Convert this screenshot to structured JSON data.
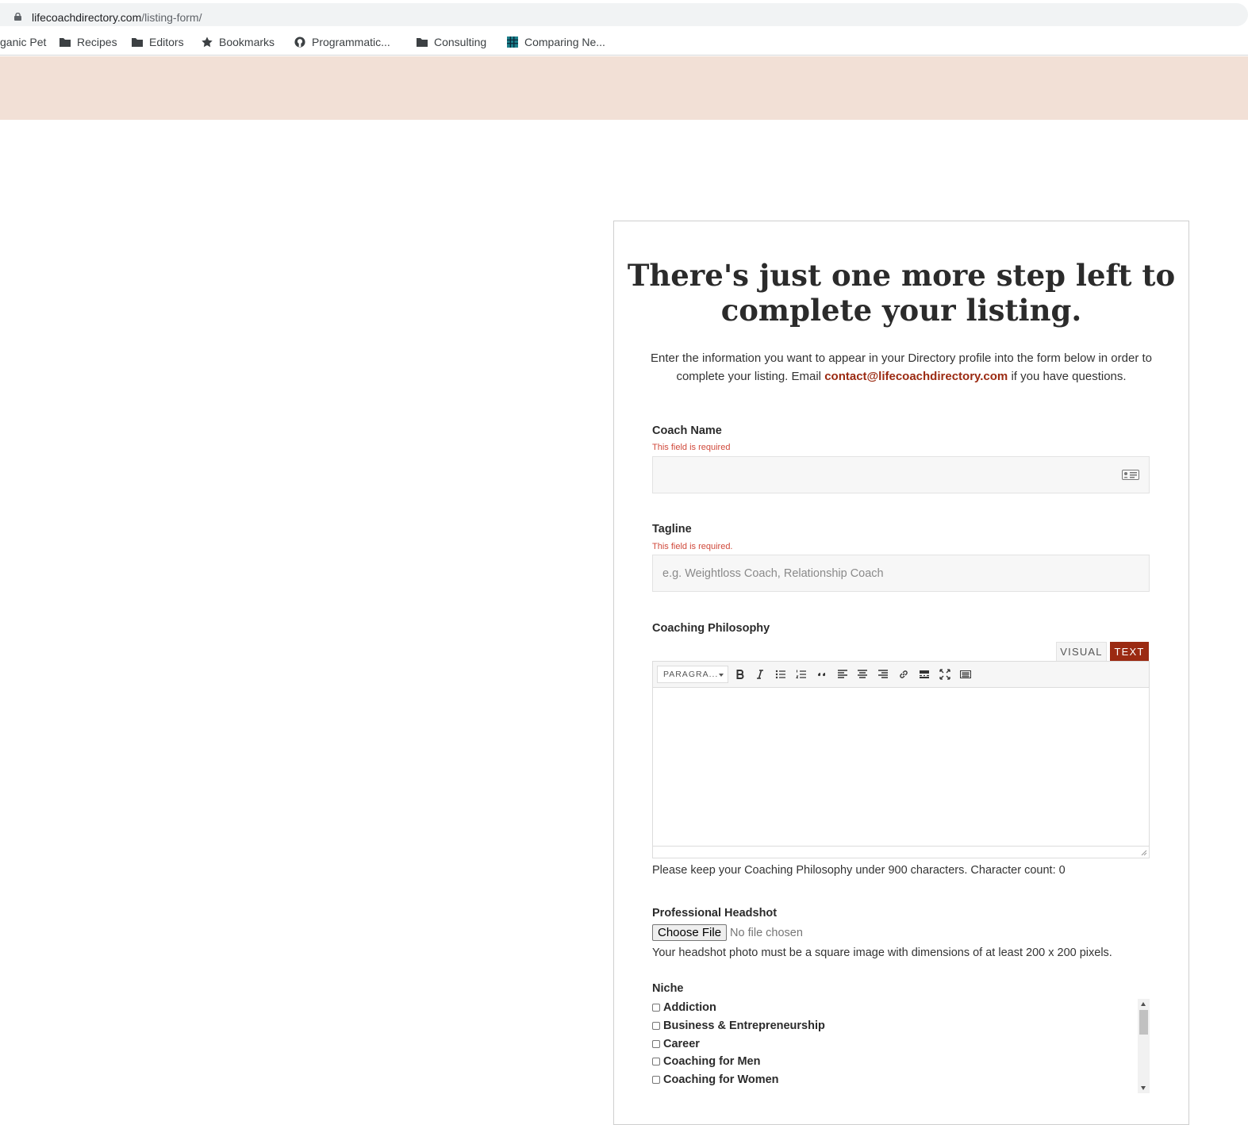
{
  "browser": {
    "url_domain": "lifecoachdirectory.com",
    "url_path": "/listing-form/",
    "bookmarks": [
      {
        "label": "ganic Pet",
        "icon": "none"
      },
      {
        "label": "Recipes",
        "icon": "folder-icon"
      },
      {
        "label": "Editors",
        "icon": "folder-icon"
      },
      {
        "label": "Bookmarks",
        "icon": "star-icon"
      },
      {
        "label": "Programmatic...",
        "icon": "github-icon"
      },
      {
        "label": "Consulting",
        "icon": "folder-icon"
      },
      {
        "label": "Comparing Ne...",
        "icon": "grid-site-icon"
      }
    ]
  },
  "colors": {
    "banner": "#f2e0d6",
    "accent": "#9b2a12",
    "error": "#d0493b"
  },
  "form": {
    "title": "There's just one more step left to complete your listing.",
    "intro_before": "Enter the information you want to appear in your Directory profile into the form below in order to complete your listing. Email ",
    "intro_email": "contact@lifecoachdirectory.com",
    "intro_after": " if you have questions.",
    "coach_name": {
      "label": "Coach Name",
      "error": "This field is required",
      "value": ""
    },
    "tagline": {
      "label": "Tagline",
      "error": "This field is required.",
      "placeholder": "e.g. Weightloss Coach, Relationship Coach",
      "value": ""
    },
    "philosophy": {
      "label": "Coaching Philosophy",
      "tab_visual": "VISUAL",
      "tab_text": "TEXT",
      "format_select": "PARAGRA...",
      "help": "Please keep your Coaching Philosophy under 900 characters. Character count: 0"
    },
    "headshot": {
      "label": "Professional Headshot",
      "button": "Choose File",
      "status": "No file chosen",
      "help": "Your headshot photo must be a square image with dimensions of at least 200 x 200 pixels."
    },
    "niche": {
      "label": "Niche",
      "options": [
        "Addiction",
        "Business & Entrepreneurship",
        "Career",
        "Coaching for Men",
        "Coaching for Women"
      ]
    }
  }
}
